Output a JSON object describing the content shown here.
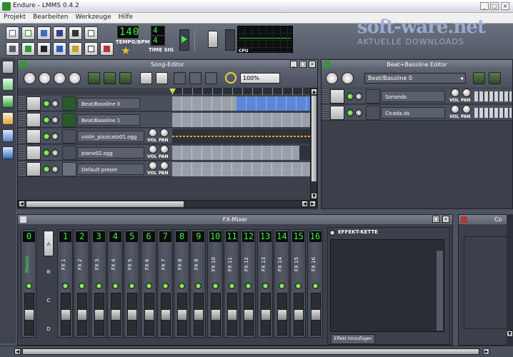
{
  "window": {
    "title": "Endure - LMMS 0.4.2",
    "minimize": "_",
    "maximize": "□",
    "close": "×"
  },
  "menu": [
    "Projekt",
    "Bearbeiten",
    "Werkzeuge",
    "Hilfe"
  ],
  "toolbar": {
    "tempo_value": "140",
    "tempo_label": "TEMPO/BPM",
    "timesig_top": "4",
    "timesig_bottom": "4",
    "timesig_label": "TIME SIG",
    "cpu_label": "CPU"
  },
  "watermark": {
    "line1": "soft-ware.net",
    "line2": "AKTUELLE DOWNLOADS"
  },
  "song_editor": {
    "title": "Song-Editor",
    "zoom": "100%",
    "tracks": [
      {
        "name": "Beat/Bassline 0"
      },
      {
        "name": "Beat/Bassline 1"
      },
      {
        "name": "violin_pizzicato01.ogg",
        "vol": "VOL",
        "pan": "PAN"
      },
      {
        "name": "piano02.ogg",
        "vol": "VOL",
        "pan": "PAN"
      },
      {
        "name": "Default preset",
        "vol": "VOL",
        "pan": "PAN"
      }
    ]
  },
  "bb_editor": {
    "title": "Beat+Bassline Editor",
    "selected": "Beat/Bassline 0",
    "tracks": [
      {
        "name": "Sonands",
        "vol": "VOL",
        "pan": "PAN"
      },
      {
        "name": "Cicada.ds",
        "vol": "VOL",
        "pan": "PAN"
      }
    ]
  },
  "fx_mixer": {
    "title": "FX-Mixer",
    "effects_title": "EFFEKT-KETTE",
    "add_effect": "Effekt hinzufügen",
    "master": {
      "num": "0",
      "name": "Master"
    },
    "channels": [
      {
        "num": "1",
        "name": "FX 1"
      },
      {
        "num": "2",
        "name": "FX 2"
      },
      {
        "num": "3",
        "name": "FX 3"
      },
      {
        "num": "4",
        "name": "FX 4"
      },
      {
        "num": "5",
        "name": "FX 5"
      },
      {
        "num": "6",
        "name": "FX 6"
      },
      {
        "num": "7",
        "name": "FX 7"
      },
      {
        "num": "8",
        "name": "FX 8"
      },
      {
        "num": "9",
        "name": "FX 9"
      },
      {
        "num": "10",
        "name": "FX 10"
      },
      {
        "num": "11",
        "name": "FX 11"
      },
      {
        "num": "12",
        "name": "FX 12"
      },
      {
        "num": "13",
        "name": "FX 13"
      },
      {
        "num": "14",
        "name": "FX 14"
      },
      {
        "num": "15",
        "name": "FX 15"
      },
      {
        "num": "16",
        "name": "FX 16"
      }
    ],
    "banks": [
      "A",
      "B",
      "C",
      "D"
    ]
  },
  "controller_rack": {
    "title": "Co"
  }
}
